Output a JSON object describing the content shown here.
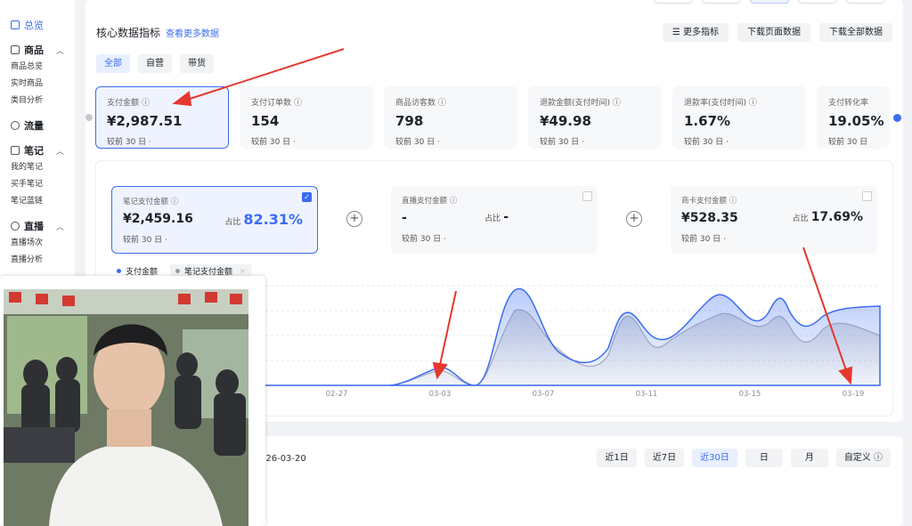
{
  "sidebar": {
    "overview": "总览",
    "sections": [
      {
        "title": "商品",
        "items": [
          "商品总览",
          "实时商品",
          "类目分析"
        ]
      },
      {
        "title": "流量",
        "items": []
      },
      {
        "title": "笔记",
        "items": [
          "我的笔记",
          "买手笔记",
          "笔记蓝链"
        ]
      },
      {
        "title": "直播",
        "items": [
          "直播场次",
          "直播分析"
        ]
      }
    ]
  },
  "header": {
    "title": "核心数据指标",
    "link": "查看更多数据",
    "more_metrics": "更多指标",
    "download_page": "下载页面数据",
    "download_all": "下载全部数据"
  },
  "tabs": [
    "全部",
    "自营",
    "带货"
  ],
  "metrics": [
    {
      "label": "支付金额",
      "value": "¥2,987.51",
      "compare": "较前 30 日"
    },
    {
      "label": "支付订单数",
      "value": "154",
      "compare": "较前 30 日"
    },
    {
      "label": "商品访客数",
      "value": "798",
      "compare": "较前 30 日"
    },
    {
      "label": "退款金额(支付时间)",
      "value": "¥49.98",
      "compare": "较前 30 日"
    },
    {
      "label": "退款率(支付时间)",
      "value": "1.67%",
      "compare": "较前 30 日"
    },
    {
      "label": "支付转化率",
      "value": "19.05%",
      "compare": "较前 30 日"
    }
  ],
  "sub_metrics": [
    {
      "label": "笔记支付金额",
      "value": "¥2,459.16",
      "share_label": "占比",
      "share": "82.31%",
      "compare": "较前 30 日"
    },
    {
      "label": "直播支付金额",
      "value": "-",
      "share_label": "占比",
      "share": "-",
      "compare": "较前 30 日"
    },
    {
      "label": "商卡支付金额",
      "value": "¥528.35",
      "share_label": "占比",
      "share": "17.69%",
      "compare": "较前 30 日"
    }
  ],
  "legend": [
    "支付金额",
    "笔记支付金额"
  ],
  "colors": {
    "accent": "#3c6df0",
    "series2": "#b0b3bb",
    "arrow": "#e5382f"
  },
  "chart_data": {
    "type": "area",
    "x_ticks": [
      "02-27",
      "03-03",
      "03-07",
      "03-11",
      "03-15",
      "03-19"
    ],
    "series": [
      {
        "name": "支付金额"
      },
      {
        "name": "笔记支付金额"
      }
    ]
  },
  "bottom": {
    "date": "026-03-20",
    "ranges": [
      "近1日",
      "近7日",
      "近30日",
      "日",
      "月",
      "自定义"
    ]
  }
}
